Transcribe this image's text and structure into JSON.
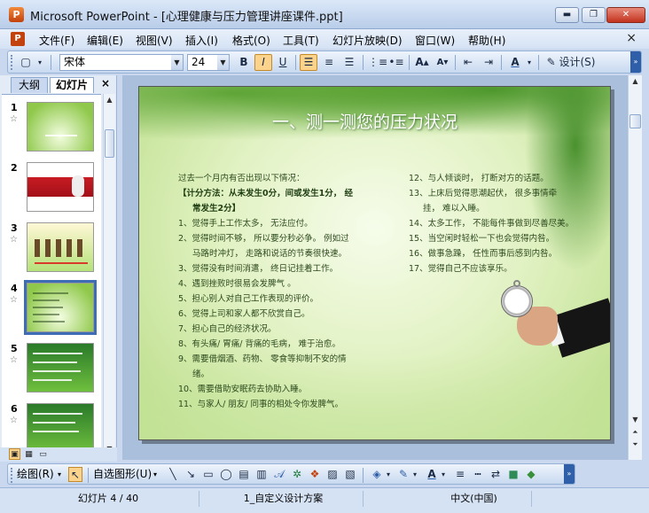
{
  "window": {
    "title": "Microsoft PowerPoint - [心理健康与压力管理讲座课件.ppt]",
    "app_icon": "P",
    "buttons": {
      "minimize": "▬",
      "maximize": "❐",
      "close": "✕"
    }
  },
  "menu": {
    "items": [
      "文件(F)",
      "编辑(E)",
      "视图(V)",
      "插入(I)",
      "格式(O)",
      "工具(T)",
      "幻灯片放映(D)",
      "窗口(W)",
      "帮助(H)"
    ],
    "close": "×"
  },
  "toolbar": {
    "font_name": "宋体",
    "font_size": "24",
    "bold": "B",
    "italic": "I",
    "underline": "U",
    "design": "设计(S)"
  },
  "panel": {
    "tab_outline": "大纲",
    "tab_slides": "幻灯片",
    "close": "×",
    "slides": [
      {
        "num": "1",
        "star": "☆"
      },
      {
        "num": "2",
        "star": ""
      },
      {
        "num": "3",
        "star": "☆"
      },
      {
        "num": "4",
        "star": "☆"
      },
      {
        "num": "5",
        "star": "☆"
      },
      {
        "num": "6",
        "star": "☆"
      }
    ],
    "selected_index": 3
  },
  "slide": {
    "title": "一、测一测您的压力状况",
    "left_column": [
      {
        "text": "过去一个月内有否出现以下情况：",
        "style": "normal"
      },
      {
        "text": "【计分方法：从未发生0分，间或发生1分，  经",
        "style": "bold"
      },
      {
        "text": "常发生2分】",
        "style": "bold-indent"
      },
      {
        "text": "1、觉得手上工作太多，   无法应付。",
        "style": "normal"
      },
      {
        "text": "2、觉得时间不够，   所以要分秒必争。  例如过",
        "style": "normal"
      },
      {
        "text": "马路时冲灯，   走路和说话的节奏很快速。",
        "style": "indent"
      },
      {
        "text": "3、觉得没有时间消遣，   终日记挂着工作。",
        "style": "normal"
      },
      {
        "text": "4、遇到挫败时很易会发脾气 。",
        "style": "normal"
      },
      {
        "text": "5、担心别人对自己工作表现的评价。",
        "style": "normal"
      },
      {
        "text": "6、觉得上司和家人都不欣赏自己。",
        "style": "normal"
      },
      {
        "text": "7、担心自己的经济状况。",
        "style": "normal"
      },
      {
        "text": "8、有头痛/ 胃痛/ 背痛的毛病，   难于治愈。",
        "style": "normal"
      },
      {
        "text": "9、需要借烟酒、药物、  零食等抑制不安的情",
        "style": "normal"
      },
      {
        "text": "绪。",
        "style": "indent"
      },
      {
        "text": "10、需要借助安眠药去协助入睡。",
        "style": "normal"
      },
      {
        "text": "11、与家人/ 朋友/ 同事的相处令你发脾气。",
        "style": "normal"
      }
    ],
    "right_column": [
      {
        "text": "12、与人倾谈时，   打断对方的话题。",
        "style": "normal"
      },
      {
        "text": "13、上床后觉得思潮起伏，   很多事情牵",
        "style": "normal"
      },
      {
        "text": "挂，   难以入睡。",
        "style": "indent"
      },
      {
        "text": "14、太多工作，   不能每件事做到尽善尽美。",
        "style": "normal"
      },
      {
        "text": "15、当空闲时轻松一下也会觉得内咎。",
        "style": "normal"
      },
      {
        "text": "16、做事急躁，   任性而事后感到内咎。",
        "style": "normal"
      },
      {
        "text": "17、觉得自己不应该享乐。",
        "style": "normal"
      }
    ]
  },
  "drawbar": {
    "draw": "绘图(R)",
    "autoshapes": "自选图形(U)"
  },
  "status": {
    "slide_info": "幻灯片 4 / 40",
    "design": "1_自定义设计方案",
    "language": "中文(中国)"
  }
}
